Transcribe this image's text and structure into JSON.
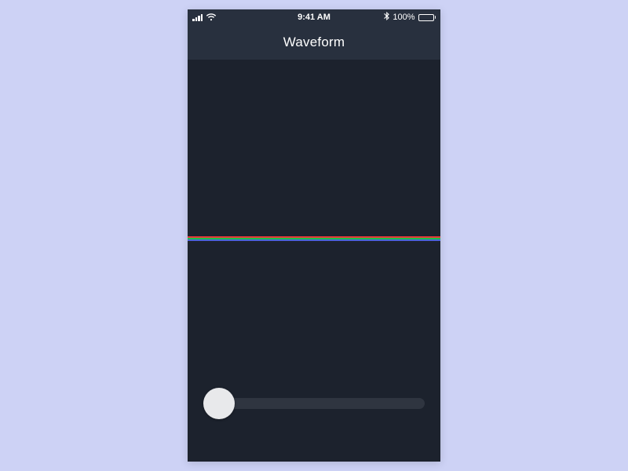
{
  "status_bar": {
    "time": "9:41 AM",
    "battery_percent": "100%"
  },
  "nav": {
    "title": "Waveform"
  },
  "waveform": {
    "lines": [
      {
        "color": "#e83a3a",
        "offset": 0
      },
      {
        "color": "#19c24a",
        "offset": 2
      },
      {
        "color": "#4a62d8",
        "offset": 4
      }
    ]
  },
  "slider": {
    "value": 0,
    "min": 0,
    "max": 100
  },
  "colors": {
    "page_bg": "#cdd2f5",
    "app_bg": "#1c222d",
    "bar_bg": "#28303e",
    "track_bg": "#2f3540",
    "thumb_bg": "#e8e9eb"
  }
}
